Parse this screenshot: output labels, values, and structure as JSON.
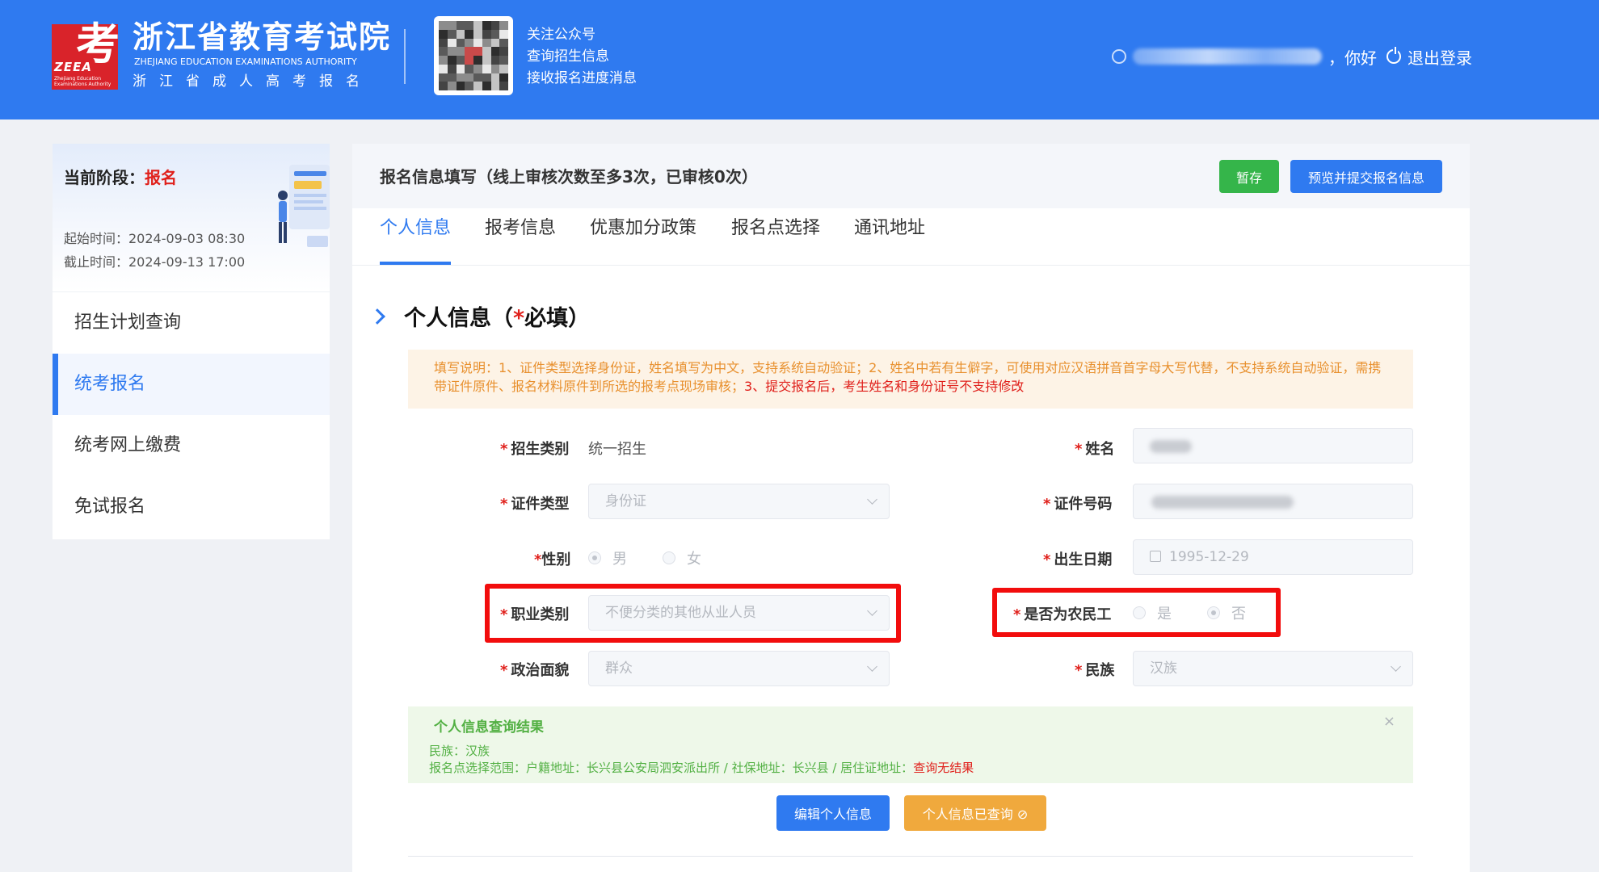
{
  "header": {
    "logo_char": "考",
    "logo_abbr": "ZEEA",
    "logo_small": "Zhejiang Education Examinations Authority",
    "org_name": "浙江省教育考试院",
    "org_name_en": "ZHEJIANG EDUCATION EXAMINATIONS AUTHORITY",
    "org_sub": "浙江省成人高考报名",
    "follow": [
      "关注公众号",
      "查询招生信息",
      "接收报名进度消息"
    ],
    "greeting": "，你好",
    "logout": "退出登录",
    "colors": {
      "bar": "#2f7af0",
      "logo": "#d9232a"
    }
  },
  "sidebar": {
    "stage_label": "当前阶段：",
    "stage_value": "报名",
    "start_time": "起始时间：2024-09-03 08:30",
    "end_time": "截止时间：2024-09-13 17:00",
    "nav": [
      "招生计划查询",
      "统考报名",
      "统考网上缴费",
      "免试报名"
    ],
    "active_index": 1
  },
  "main": {
    "title": "报名信息填写（线上审核次数至多3次，已审核0次）",
    "save_label": "暂存",
    "submit_label": "预览并提交报名信息",
    "tabs": [
      "个人信息",
      "报考信息",
      "优惠加分政策",
      "报名点选择",
      "通讯地址"
    ],
    "active_tab": 0,
    "section_title_pre": "个人信息（",
    "section_title_star": "*",
    "section_title_post": "必填）",
    "notice_orange": "填写说明：1、证件类型选择身份证，姓名填写为中文，支持系统自动验证；2、姓名中若有生僻字，可使用对应汉语拼音首字母大写代替，不支持系统自动验证，需携带证件原件、报名材料原件到所选的报考点现场审核；",
    "notice_red": "3、提交报名后，考生姓名和身份证号不支持修改",
    "fields": {
      "enroll_type": {
        "label": "招生类别",
        "value": "统一招生"
      },
      "name": {
        "label": "姓名"
      },
      "id_type": {
        "label": "证件类型",
        "value": "身份证"
      },
      "id_number": {
        "label": "证件号码"
      },
      "gender": {
        "label": "性别",
        "options": [
          "男",
          "女"
        ],
        "selected": "男"
      },
      "birth": {
        "label": "出生日期",
        "value": "1995-12-29"
      },
      "occupation": {
        "label": "职业类别",
        "value": "不便分类的其他从业人员"
      },
      "migrant": {
        "label": "是否为农民工",
        "options": [
          "是",
          "否"
        ],
        "selected": "否"
      },
      "political": {
        "label": "政治面貌",
        "value": "群众"
      },
      "ethnicity": {
        "label": "民族",
        "value": "汉族"
      }
    },
    "result": {
      "title": "个人信息查询结果",
      "line1": "民族：汉族",
      "line2": "报名点选择范围：户籍地址：长兴县公安局泗安派出所 / 社保地址：长兴县 / 居住证地址：",
      "line2_red": "查询无结果",
      "close": "×"
    },
    "edit_label": "编辑个人信息",
    "checked_label": "个人信息已查询 ⊘",
    "colors": {
      "primary": "#2f7af0",
      "success": "#35b54a",
      "warning": "#f0a93d",
      "danger": "#e0201b",
      "highlight": "#f20d0d"
    }
  }
}
